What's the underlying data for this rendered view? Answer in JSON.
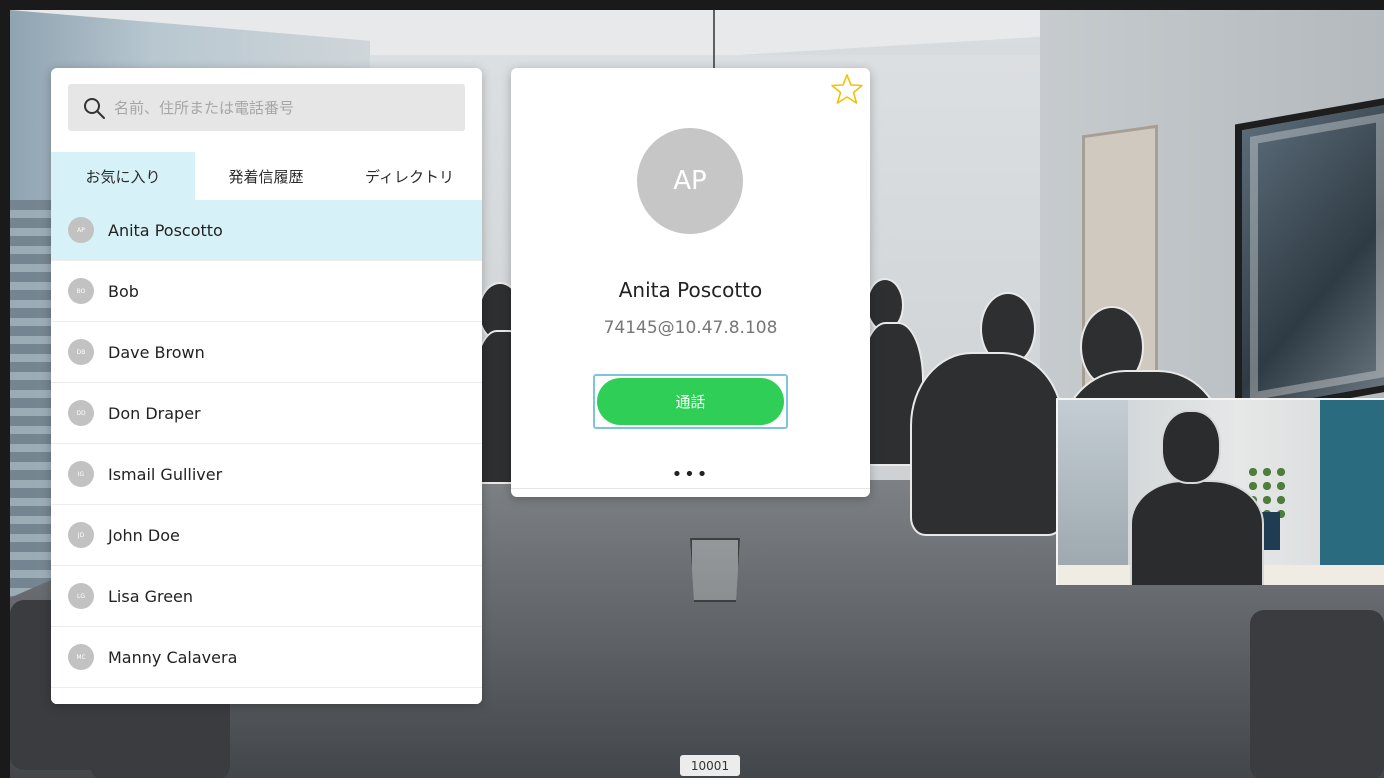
{
  "search": {
    "placeholder": "名前、住所または電話番号"
  },
  "tabs": [
    {
      "label": "お気に入り",
      "active": true
    },
    {
      "label": "発着信履歴",
      "active": false
    },
    {
      "label": "ディレクトリ",
      "active": false
    }
  ],
  "contacts": [
    {
      "initials": "AP",
      "name": "Anita Poscotto",
      "selected": true
    },
    {
      "initials": "BO",
      "name": "Bob"
    },
    {
      "initials": "DB",
      "name": "Dave Brown"
    },
    {
      "initials": "DD",
      "name": "Don Draper"
    },
    {
      "initials": "IG",
      "name": "Ismail Gulliver"
    },
    {
      "initials": "JD",
      "name": "John Doe"
    },
    {
      "initials": "LG",
      "name": "Lisa Green"
    },
    {
      "initials": "MC",
      "name": "Manny Calavera"
    }
  ],
  "detail": {
    "initials": "AP",
    "name": "Anita Poscotto",
    "address": "74145@10.47.8.108",
    "call_label": "通話",
    "more_label": "•••",
    "favorite_icon": "star-icon"
  },
  "footer": {
    "badge": "10001"
  },
  "colors": {
    "accent_green": "#2fce57",
    "selected_row": "#d7f1f8",
    "star": "#f2c200"
  }
}
